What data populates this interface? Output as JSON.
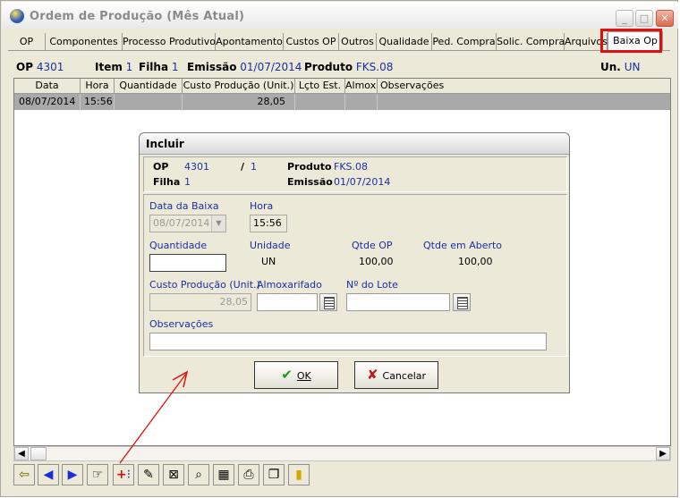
{
  "window": {
    "title": "Ordem de Produção  (Mês Atual)"
  },
  "tabs": [
    "OP",
    "Componentes",
    "Processo Produtivo",
    "Apontamento",
    "Custos OP",
    "Outros",
    "Qualidade",
    "Ped. Compra",
    "Solic. Compra",
    "Arquivos",
    "Baixa Op"
  ],
  "info": {
    "op_label": "OP",
    "op_value": "4301",
    "item_label": "Item",
    "item_value": "1",
    "filha_label": "Filha",
    "filha_value": "1",
    "emissao_label": "Emissão",
    "emissao_value": "01/07/2014",
    "produto_label": "Produto",
    "produto_value": "FKS.08",
    "un_label": "Un.",
    "un_value": "UN"
  },
  "grid": {
    "columns": [
      "Data",
      "Hora",
      "Quantidade",
      "Custo Produção (Unit.)",
      "Lçto Est.",
      "Almox.",
      "Observações"
    ],
    "rows": [
      {
        "data": "08/07/2014",
        "hora": "15:56",
        "quantidade": "",
        "custo": "28,05",
        "lcto": "",
        "almox": "",
        "obs": ""
      }
    ]
  },
  "dialog": {
    "title": "Incluir",
    "op_label": "OP",
    "op_value": "4301",
    "sep": "/",
    "item_value": "1",
    "produto_label": "Produto",
    "produto_value": "FKS.08",
    "filha_label": "Filha",
    "filha_value": "1",
    "emissao_label": "Emissão",
    "emissao_value": "01/07/2014",
    "data_baixa_label": "Data da Baixa",
    "data_baixa_value": "08/07/2014",
    "hora_label": "Hora",
    "hora_value": "15:56",
    "quantidade_label": "Quantidade",
    "quantidade_value": "",
    "unidade_label": "Unidade",
    "unidade_value": "UN",
    "qtde_op_label": "Qtde OP",
    "qtde_op_value": "100,00",
    "qtde_aberto_label": "Qtde em Aberto",
    "qtde_aberto_value": "100,00",
    "custo_label": "Custo Produção (Unit.)",
    "custo_value": "28,05",
    "almox_label": "Almoxarifado",
    "almox_value": "",
    "lote_label": "Nº do Lote",
    "lote_value": "",
    "obs_label": "Observações",
    "obs_value": "",
    "ok_label": "OK",
    "cancel_label": "Cancelar"
  },
  "colors": {
    "accent_blue": "#1a2fa0",
    "highlight_red": "#e01010",
    "row_selected": "#a9a9a9"
  }
}
